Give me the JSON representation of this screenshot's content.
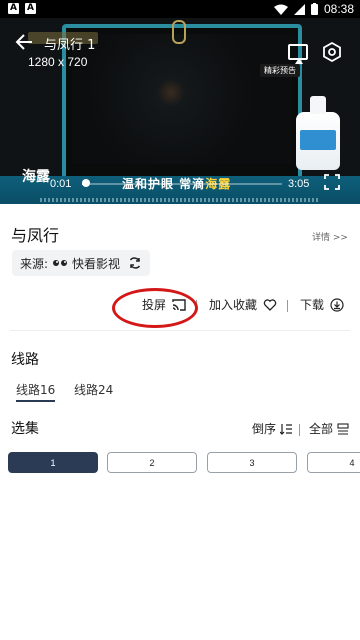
{
  "status_bar": {
    "time": "08:38",
    "notif_1": "A",
    "notif_2": "A"
  },
  "player": {
    "title": "与凤行 1",
    "resolution": "1280 x 720",
    "current_time": "0:01",
    "total_time": "3:05",
    "progress_fraction": 0.02,
    "ad_badge": "精彩预告",
    "ad_slogan_a": "温和护眼 常滴",
    "ad_slogan_b": "海露",
    "logo_text": "海露"
  },
  "show": {
    "title": "与凤行",
    "details_link": "详情 >>",
    "source_label": "来源:",
    "source_name": "快看影视"
  },
  "actions": {
    "cast_label": "投屏",
    "favorite_label": "加入收藏",
    "download_label": "下载"
  },
  "routes": {
    "heading": "线路",
    "items": [
      {
        "label": "线路16",
        "active": true
      },
      {
        "label": "线路24",
        "active": false
      }
    ]
  },
  "episodes": {
    "heading": "选集",
    "order_label": "倒序",
    "all_label": "全部",
    "items": [
      "1",
      "2",
      "3",
      "4"
    ]
  },
  "colors": {
    "accent": "#2b3a55",
    "annotation": "#d41818"
  }
}
